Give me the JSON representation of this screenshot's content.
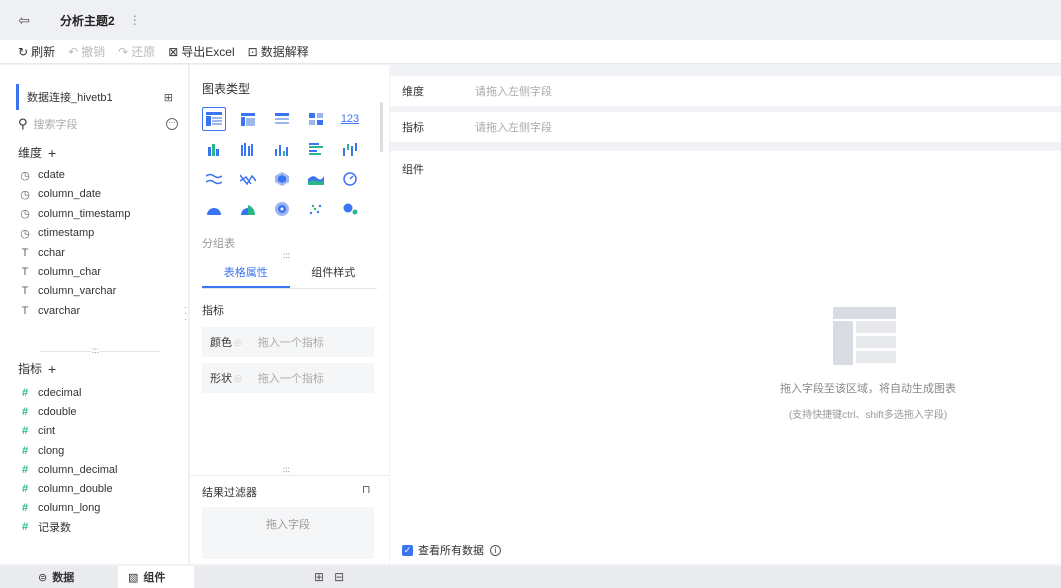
{
  "topbar": {
    "tab_title": "分析主题2",
    "more_icon": "⋮"
  },
  "toolbar": {
    "refresh": "刷新",
    "undo": "撤销",
    "redo": "还原",
    "export": "导出Excel",
    "explain": "数据解释"
  },
  "left": {
    "datasource": "数据连接_hivetb1",
    "search_placeholder": "搜索字段",
    "dimensions_title": "维度",
    "dimensions": [
      "cdate",
      "column_date",
      "column_timestamp",
      "ctimestamp",
      "cchar",
      "column_char",
      "column_varchar",
      "cvarchar"
    ],
    "measures_title": "指标",
    "measures": [
      "cdecimal",
      "cdouble",
      "cint",
      "clong",
      "column_decimal",
      "column_double",
      "column_long",
      "记录数"
    ]
  },
  "middle": {
    "chart_type_title": "图表类型",
    "group_label": "分组表",
    "tabs": [
      "表格属性",
      "组件样式"
    ],
    "measure_title": "指标",
    "color_label": "颜色",
    "color_placeholder": "拖入一个指标",
    "shape_label": "形状",
    "shape_placeholder": "拖入一个指标",
    "filter_title": "结果过滤器",
    "filter_placeholder": "拖入字段",
    "chart_type_123": "123"
  },
  "right": {
    "dimension_label": "维度",
    "dimension_placeholder": "请拖入左侧字段",
    "measure_label": "指标",
    "measure_placeholder": "请拖入左侧字段",
    "canvas_title": "组件",
    "empty_hint": "拖入字段至该区域，将自动生成图表",
    "empty_subhint": "(支持快捷键ctrl、shift多选拖入字段)",
    "view_all": "查看所有数据"
  },
  "bottombar": {
    "data_tab": "数据",
    "component_tab": "组件"
  },
  "colors": {
    "accent": "#3a74f2",
    "measure_icon": "#2bb58a"
  }
}
